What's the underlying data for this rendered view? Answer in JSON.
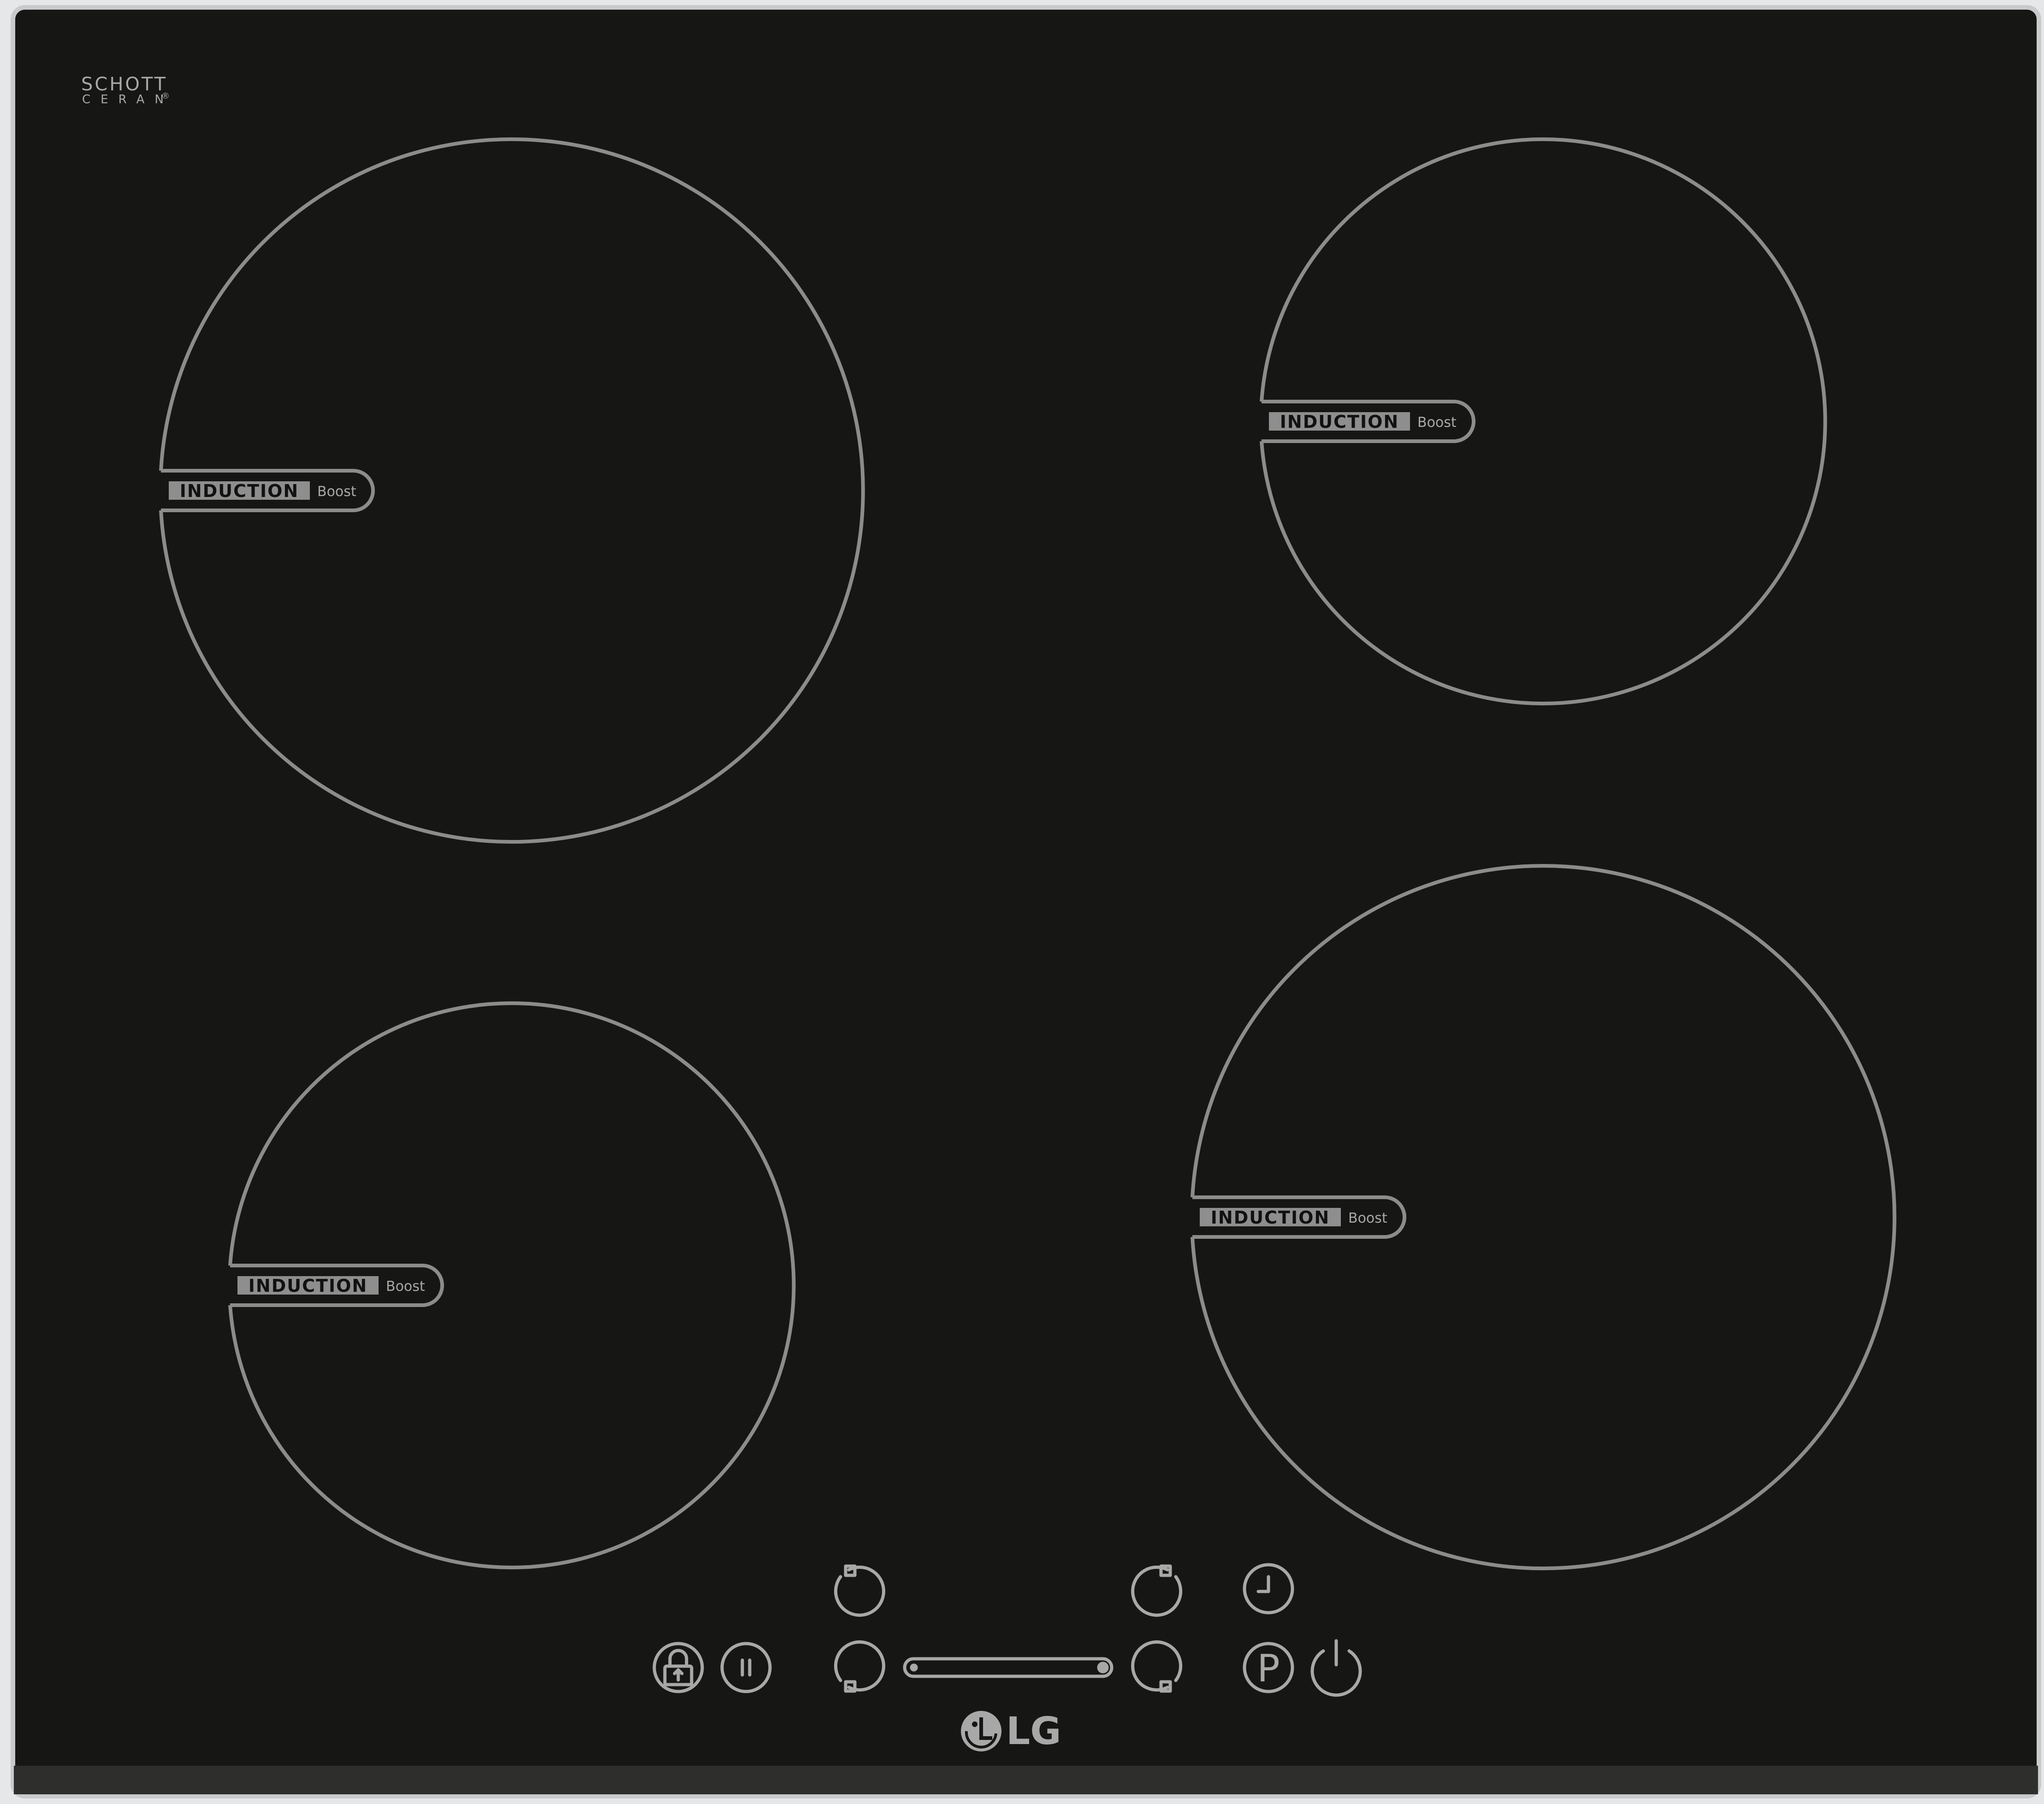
{
  "brand": {
    "glass_maker_line1": "SCHOTT",
    "glass_maker_line2": "CERAN",
    "glass_maker_mark": "®",
    "manufacturer_logo": "LG"
  },
  "zones": [
    {
      "id": "front-left-large",
      "badge": "INDUCTION",
      "badge_suffix": "Boost"
    },
    {
      "id": "rear-right-small",
      "badge": "INDUCTION",
      "badge_suffix": "Boost"
    },
    {
      "id": "front-left-medium",
      "badge": "INDUCTION",
      "badge_suffix": "Boost"
    },
    {
      "id": "front-right-large",
      "badge": "INDUCTION",
      "badge_suffix": "Boost"
    }
  ],
  "controls": {
    "lock": {
      "icon": "lock-icon"
    },
    "pause": {
      "icon": "pause-icon"
    },
    "zone_selectors": [
      {
        "icon": "zone-rear-left-icon"
      },
      {
        "icon": "zone-front-left-icon"
      },
      {
        "icon": "zone-rear-right-icon"
      },
      {
        "icon": "zone-front-right-icon"
      }
    ],
    "slider": {
      "icon": "power-slider"
    },
    "timer": {
      "icon": "clock-icon"
    },
    "program": {
      "icon": "program-p-icon",
      "label": "P"
    },
    "power": {
      "icon": "power-icon"
    }
  },
  "colors": {
    "glass": "#161615",
    "frame": "#c9cacc",
    "outline": "#8c8c8c",
    "badge_fill": "#8e8e8e",
    "badge_text": "#111111",
    "print": "#a8a8a8",
    "front_strip": "#2e2e2d"
  }
}
